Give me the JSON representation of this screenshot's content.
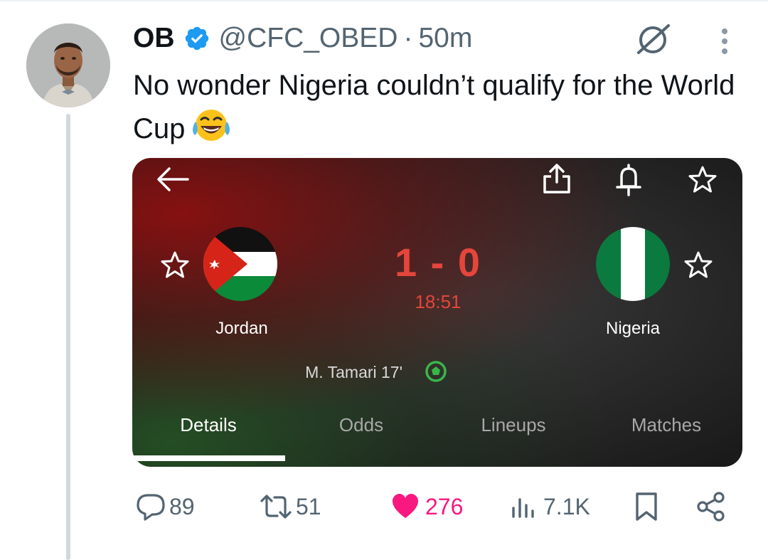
{
  "tweet": {
    "author_name": "OB",
    "handle": "@CFC_OBED",
    "separator": "·",
    "time": "50m",
    "text": "No wonder Nigeria couldn’t qualify for the World Cup",
    "emoji": "face-with-tears-of-joy"
  },
  "match_card": {
    "home_team": "Jordan",
    "away_team": "Nigeria",
    "score": "1 - 0",
    "clock": "18:51",
    "scorer": "M. Tamari 17'",
    "tabs": [
      {
        "label": "Details",
        "active": true
      },
      {
        "label": "Odds",
        "active": false
      },
      {
        "label": "Lineups",
        "active": false
      },
      {
        "label": "Matches",
        "active": false
      }
    ],
    "colors": {
      "score": "#e5453b",
      "goal_icon": "#3bb54a"
    }
  },
  "actions": {
    "replies": "89",
    "retweets": "51",
    "likes": "276",
    "views": "7.1K",
    "like_color": "#f91880"
  },
  "colors": {
    "verified": "#1d9bf0",
    "muted": "#536471",
    "thread_line": "#cfd9de"
  }
}
